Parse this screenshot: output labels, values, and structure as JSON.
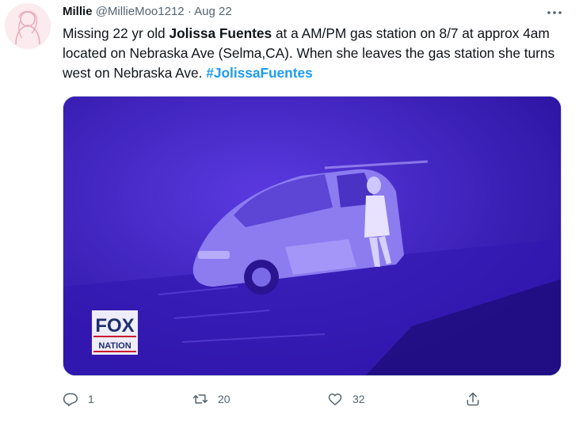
{
  "user": {
    "name": "Millie",
    "handle": "@MillieMoo1212",
    "separator": "·",
    "date": "Aug 22"
  },
  "tweet": {
    "t1": "Missing 22 yr old ",
    "t_bold": "Jolissa Fuentes",
    "t2": " at a AM/PM gas station on 8/7 at approx 4am located on Nebraska Ave (Selma,CA). When she leaves the gas station she turns west on Nebraska Ave. ",
    "hashtag": "#JolissaFuentes"
  },
  "media": {
    "logo_line1": "FOX",
    "logo_line2": "NATION"
  },
  "actions": {
    "reply_count": "1",
    "retweet_count": "20",
    "like_count": "32"
  },
  "colors": {
    "link": "#1d9bf0",
    "secondary_text": "#536471",
    "video_tint": "#3a1cc2"
  },
  "icons": {
    "more": "more-icon",
    "reply": "reply-icon",
    "retweet": "retweet-icon",
    "like": "like-icon",
    "share": "share-icon"
  }
}
